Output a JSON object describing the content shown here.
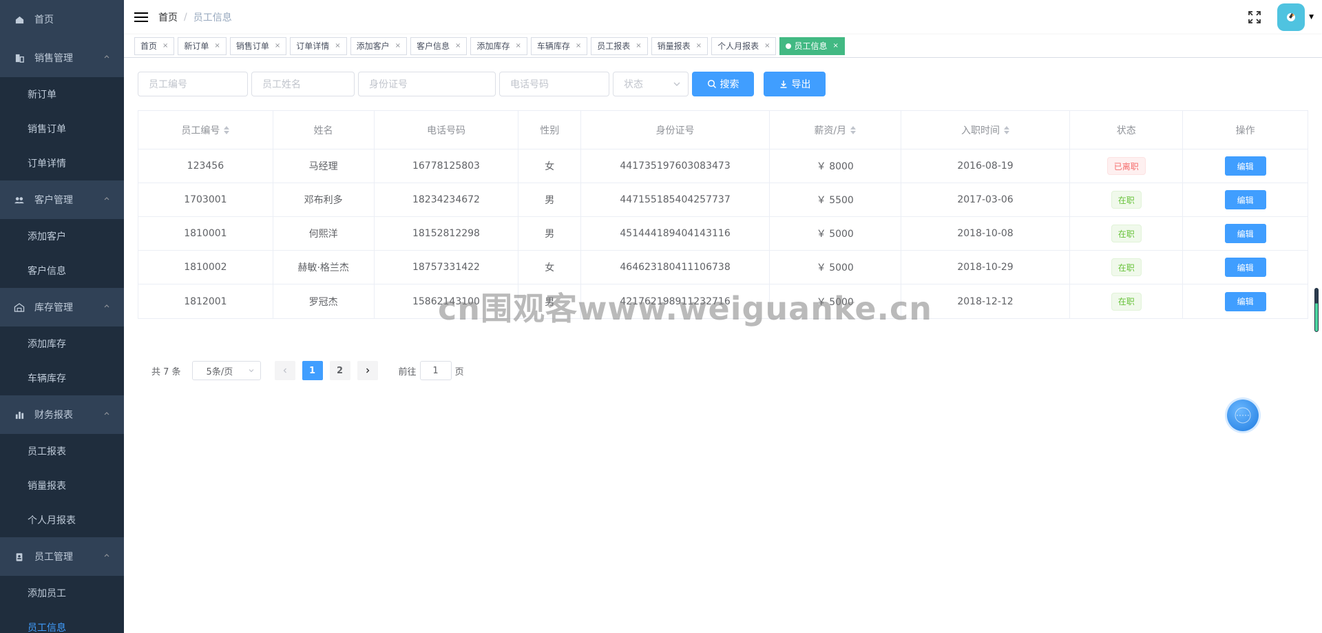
{
  "sidebar": {
    "home": "首页",
    "groups": [
      {
        "label": "销售管理",
        "icon": "sales-icon",
        "items": [
          "新订单",
          "销售订单",
          "订单详情"
        ]
      },
      {
        "label": "客户管理",
        "icon": "customers-icon",
        "items": [
          "添加客户",
          "客户信息"
        ]
      },
      {
        "label": "库存管理",
        "icon": "warehouse-icon",
        "items": [
          "添加库存",
          "车辆库存"
        ]
      },
      {
        "label": "财务报表",
        "icon": "bar-chart-icon",
        "items": [
          "员工报表",
          "销量报表",
          "个人月报表"
        ]
      },
      {
        "label": "员工管理",
        "icon": "badge-icon",
        "items": [
          "添加员工",
          "员工信息"
        ]
      }
    ]
  },
  "header": {
    "breadcrumb_home": "首页",
    "breadcrumb_sep": "/",
    "breadcrumb_current": "员工信息"
  },
  "tags": [
    "首页",
    "新订单",
    "销售订单",
    "订单详情",
    "添加客户",
    "客户信息",
    "添加库存",
    "车辆库存",
    "员工报表",
    "销量报表",
    "个人月报表",
    "员工信息"
  ],
  "tags_active": "员工信息",
  "filter": {
    "emp_no_placeholder": "员工编号",
    "name_placeholder": "员工姓名",
    "id_placeholder": "身份证号",
    "phone_placeholder": "电话号码",
    "status_placeholder": "状态",
    "search_label": "搜索",
    "export_label": "导出"
  },
  "table": {
    "headers": [
      "员工编号",
      "姓名",
      "电话号码",
      "性别",
      "身份证号",
      "薪资/月",
      "入职时间",
      "状态",
      "操作"
    ],
    "rows": [
      {
        "id": "123456",
        "name": "马经理",
        "phone": "16778125803",
        "gender": "女",
        "idcard": "441735197603083473",
        "salary": "￥ 8000",
        "date": "2016-08-19",
        "status": "已离职",
        "status_type": "left",
        "action": "编辑"
      },
      {
        "id": "1703001",
        "name": "邓布利多",
        "phone": "18234234672",
        "gender": "男",
        "idcard": "447155185404257737",
        "salary": "￥ 5500",
        "date": "2017-03-06",
        "status": "在职",
        "status_type": "on",
        "action": "编辑"
      },
      {
        "id": "1810001",
        "name": "何熙洋",
        "phone": "18152812298",
        "gender": "男",
        "idcard": "451444189404143116",
        "salary": "￥ 5000",
        "date": "2018-10-08",
        "status": "在职",
        "status_type": "on",
        "action": "编辑"
      },
      {
        "id": "1810002",
        "name": "赫敏·格兰杰",
        "phone": "18757331422",
        "gender": "女",
        "idcard": "464623180411106738",
        "salary": "￥ 5000",
        "date": "2018-10-29",
        "status": "在职",
        "status_type": "on",
        "action": "编辑"
      },
      {
        "id": "1812001",
        "name": "罗冠杰",
        "phone": "15862143100",
        "gender": "男",
        "idcard": "421762198911232716",
        "salary": "￥ 5000",
        "date": "2018-12-12",
        "status": "在职",
        "status_type": "on",
        "action": "编辑"
      }
    ]
  },
  "pagination": {
    "total": "共 7 条",
    "page_size": "5条/页",
    "pages": [
      "1",
      "2"
    ],
    "current": "1",
    "goto_prefix": "前往",
    "goto_value": "1",
    "goto_suffix": "页"
  },
  "watermark": "cn围观客www.weiguanke.cn",
  "colors": {
    "sidebar_bg": "#304156",
    "primary": "#409eff",
    "active_tag": "#42b983"
  }
}
